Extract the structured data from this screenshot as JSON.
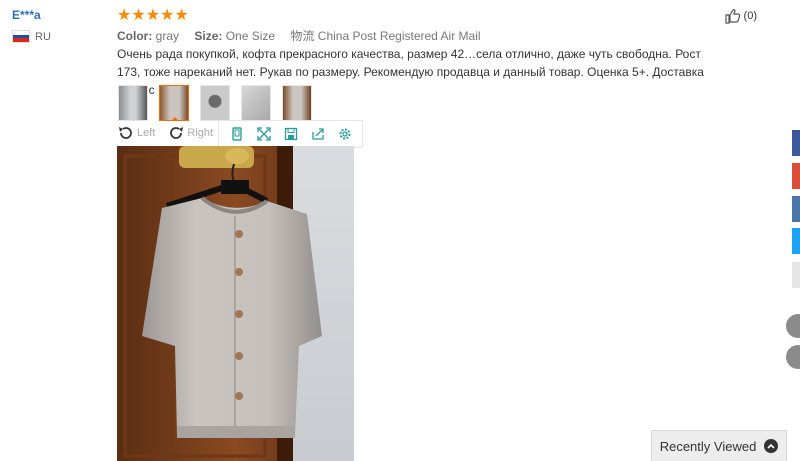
{
  "reviewer": {
    "name": "E***a",
    "country": "RU"
  },
  "review": {
    "stars": "★★★★★",
    "color_label": "Color:",
    "color_value": "gray",
    "size_label": "Size:",
    "size_value": "One Size",
    "shipping_label": "物流",
    "shipping_value": "China Post Registered Air Mail",
    "text": "Очень рада покупкой, кофта прекрасного качества, размер 42…села отлично, даже чуть свободна. Рост 173, тоже нареканий нет. Рукав по размеру. Рекомендую продавца и данный товар. Оценка 5+. Доставка 1.5мес",
    "helpful_count": "(0)",
    "rating": 5
  },
  "toolbar": {
    "rotate_left": "Left",
    "rotate_right": "Right",
    "icons": [
      "phone-view-icon",
      "fullscreen-icon",
      "save-icon",
      "share-icon",
      "settings-icon"
    ]
  },
  "thumbnails": [
    "thumbnail-1",
    "thumbnail-2",
    "thumbnail-3",
    "thumbnail-4",
    "thumbnail-5"
  ],
  "active_thumbnail": 2,
  "recently_viewed": "Recently Viewed",
  "colors": {
    "accent": "#ff6a00",
    "star": "#ff8a00",
    "link": "#2e6db5",
    "teal": "#2a9d9a"
  }
}
